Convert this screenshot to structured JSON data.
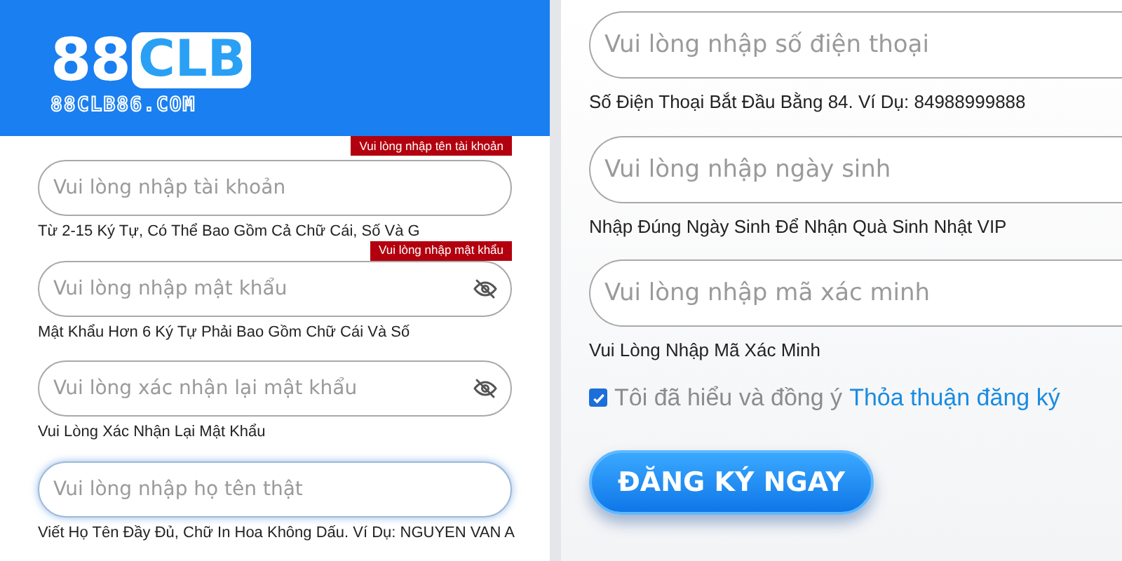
{
  "logo": {
    "number": "88",
    "letters": "CLB",
    "domain": "88CLB86.COM"
  },
  "left_fields": [
    {
      "placeholder": "Vui lòng nhập tài khoản",
      "hint": "Từ 2-15 Ký Tự, Có Thể Bao Gồm Cả Chữ Cái, Số Và G",
      "error": "Vui lòng nhập tên tài khoản",
      "password_toggle": false,
      "focused": false
    },
    {
      "placeholder": "Vui lòng nhập mật khẩu",
      "hint": "Mật Khẩu Hơn 6 Ký Tự Phải Bao Gồm Chữ Cái Và Số",
      "error": "Vui lòng nhập mật khẩu",
      "password_toggle": true,
      "focused": false
    },
    {
      "placeholder": "Vui lòng xác nhận lại mật khẩu",
      "hint": "Vui Lòng Xác Nhận Lại Mật Khẩu",
      "password_toggle": true,
      "focused": false
    },
    {
      "placeholder": "Vui lòng nhập họ tên thật",
      "hint": "Viết Họ Tên Đầy Đủ, Chữ In Hoa Không Dấu. Ví Dụ: NGUYEN VAN A",
      "password_toggle": false,
      "focused": true
    }
  ],
  "right_fields": [
    {
      "placeholder": "Vui lòng nhập số điện thoại",
      "hint": "Số Điện Thoại Bắt Đầu Bằng 84. Ví Dụ: 84988999888"
    },
    {
      "placeholder": "Vui lòng nhập ngày sinh",
      "hint": "Nhập Đúng Ngày Sinh Để Nhận Quà Sinh Nhật VIP"
    },
    {
      "placeholder": "Vui lòng nhập mã xác minh",
      "hint": "Vui Lòng Nhập Mã Xác Minh"
    }
  ],
  "agreement": {
    "checked": true,
    "text": "Tôi đã hiểu và đồng ý",
    "link": "Thỏa thuận đăng ký"
  },
  "submit_button": "ĐĂNG KÝ NGAY"
}
